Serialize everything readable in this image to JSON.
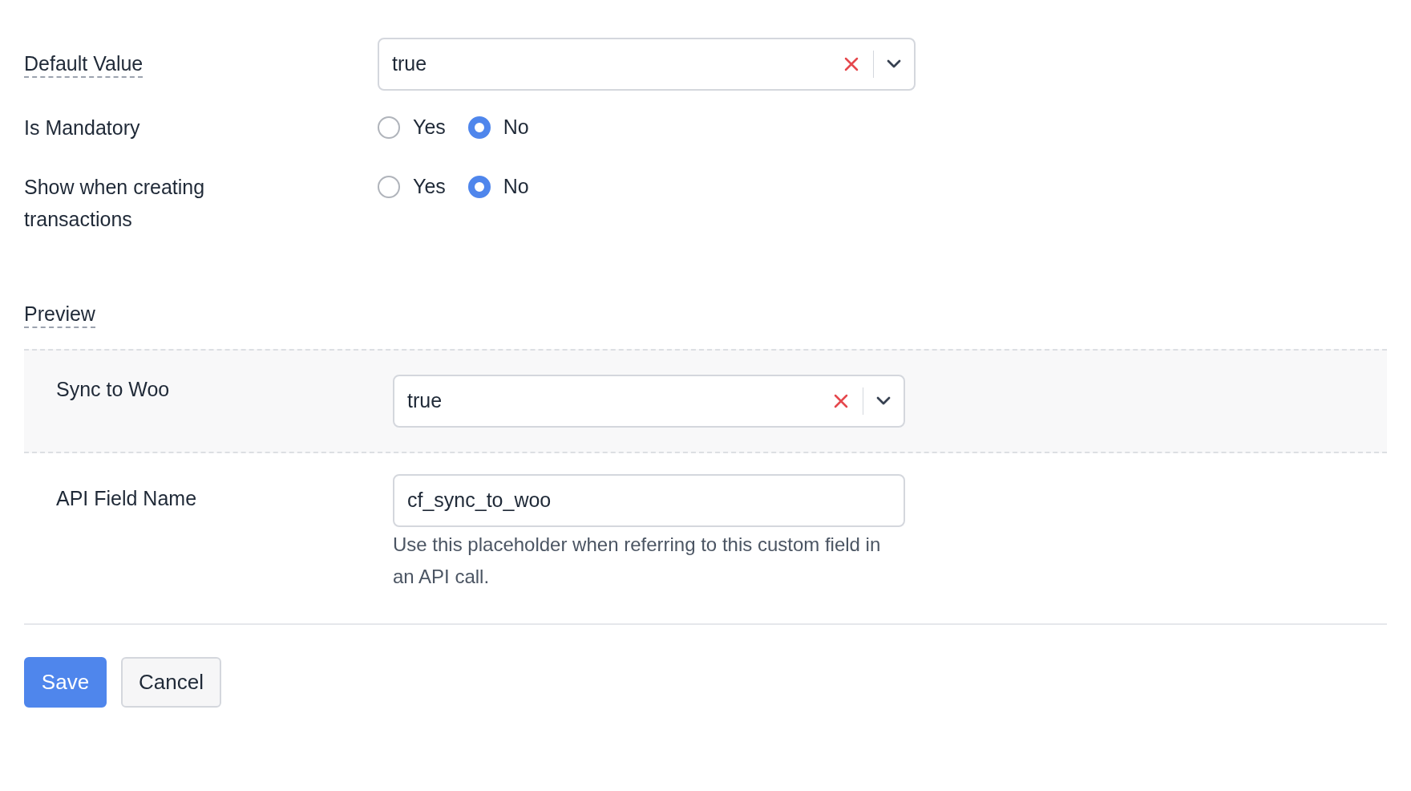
{
  "default_value": {
    "label": "Default Value",
    "value": "true"
  },
  "radio_groups": [
    {
      "label": "Is Mandatory",
      "options": [
        {
          "label": "Yes",
          "selected": false
        },
        {
          "label": "No",
          "selected": true
        }
      ]
    },
    {
      "label": "Show when creating transactions",
      "options": [
        {
          "label": "Yes",
          "selected": false
        },
        {
          "label": "No",
          "selected": true
        }
      ]
    }
  ],
  "preview": {
    "title": "Preview",
    "field_label": "Sync to Woo",
    "value": "true"
  },
  "api_field": {
    "label": "API Field Name",
    "value": "cf_sync_to_woo",
    "help": "Use this placeholder when referring to this custom field in an API call."
  },
  "buttons": [
    {
      "kind": "primary",
      "label": "Save"
    },
    {
      "kind": "secondary",
      "label": "Cancel"
    }
  ]
}
